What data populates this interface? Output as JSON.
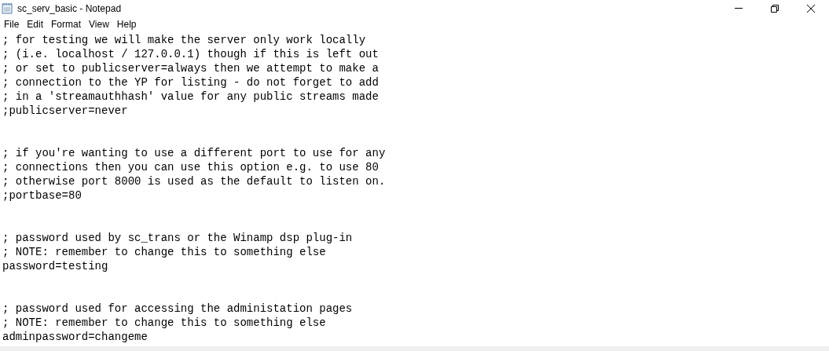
{
  "window": {
    "title": "sc_serv_basic - Notepad"
  },
  "menu": [
    "File",
    "Edit",
    "Format",
    "View",
    "Help"
  ],
  "blocks": [
    {
      "lines": [
        "; for testing we will make the server only work locally",
        "; (i.e. localhost / 127.0.0.1) though if this is left out",
        "; or set to publicserver=always then we attempt to make a",
        "; connection to the YP for listing - do not forget to add",
        "; in a 'streamauthhash' value for any public streams made",
        ";publicserver=never"
      ]
    },
    {
      "lines": [
        "; if you're wanting to use a different port to use for any",
        "; connections then you can use this option e.g. to use 80",
        "; otherwise port 8000 is used as the default to listen on.",
        ";portbase=80"
      ]
    },
    {
      "lines": [
        "; password used by sc_trans or the Winamp dsp plug-in",
        "; NOTE: remember to change this to something else",
        "password=testing"
      ]
    },
    {
      "lines": [
        "; password used for accessing the administation pages",
        "; NOTE: remember to change this to something else",
        "adminpassword=changeme"
      ]
    }
  ]
}
